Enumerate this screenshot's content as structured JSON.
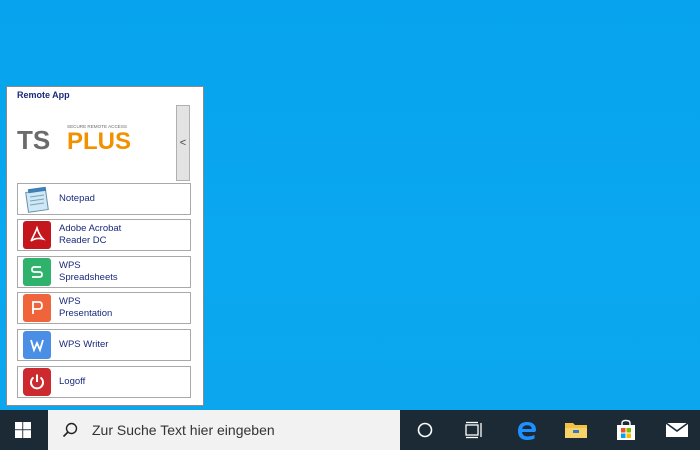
{
  "panel": {
    "title": "Remote App",
    "logo": {
      "text_ts": "TS",
      "text_plus": "PLUS",
      "tagline": "SECURE REMOTE ACCESS"
    },
    "collapse_label": "<",
    "apps": [
      {
        "label": "Notepad",
        "icon": "notepad-icon"
      },
      {
        "label": "Adobe Acrobat\nReader DC",
        "icon": "acrobat-icon",
        "color": "#c4161c"
      },
      {
        "label": "WPS\nSpreadsheets",
        "icon": "wps-spreadsheets-icon",
        "color": "#2fb36c"
      },
      {
        "label": "WPS\nPresentation",
        "icon": "wps-presentation-icon",
        "color": "#f0643c"
      },
      {
        "label": "WPS Writer",
        "icon": "wps-writer-icon",
        "color": "#4a8ee6"
      },
      {
        "label": "Logoff",
        "icon": "power-icon",
        "color": "#cc2a2f"
      }
    ]
  },
  "taskbar": {
    "search_placeholder": "Zur Suche Text hier eingeben",
    "icons": [
      "windows-start-icon",
      "search-icon",
      "cortana-icon",
      "task-view-icon",
      "edge-icon",
      "file-explorer-icon",
      "store-icon",
      "mail-icon"
    ]
  },
  "colors": {
    "desktop": "#0aa6f0",
    "taskbar": "#1b2a35",
    "label": "#1a2a7a"
  }
}
